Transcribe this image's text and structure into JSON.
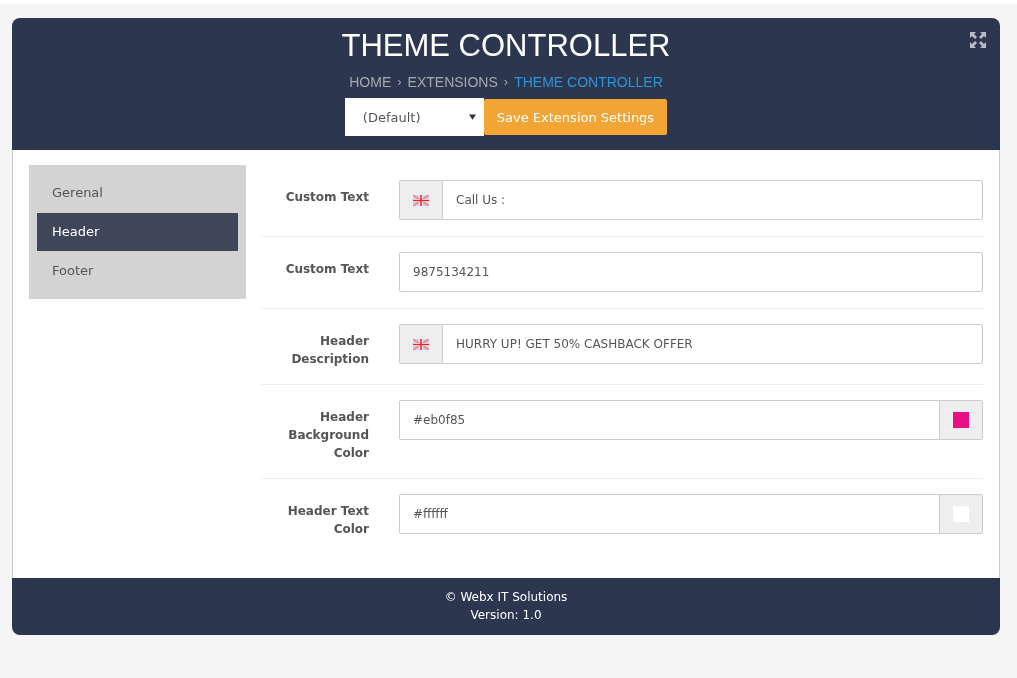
{
  "title": "THEME CONTROLLER",
  "breadcrumb": [
    {
      "label": "HOME",
      "selected": false
    },
    {
      "separator": "›",
      "label": "EXTENSIONS",
      "selected": false
    },
    {
      "separator": "›",
      "label": "THEME CONTROLLER",
      "selected": true
    }
  ],
  "store_select": {
    "value": "(Default)"
  },
  "save_button": "Save Extension Settings",
  "sidebar": {
    "items": [
      {
        "label": "Gerenal",
        "selected": false
      },
      {
        "label": "Header",
        "selected": true
      },
      {
        "label": "Footer",
        "selected": false
      }
    ]
  },
  "fields": [
    {
      "kind": "flag",
      "label": "Custom Text",
      "value": "Call Us :"
    },
    {
      "kind": "plain",
      "label": "Custom Text",
      "value": "9875134211"
    },
    {
      "kind": "flag",
      "label": "Header Description",
      "value": "HURRY UP! GET 50% CASHBACK OFFER"
    },
    {
      "kind": "color",
      "label": "Header Background Color",
      "value": "#eb0f85",
      "color": "#eb0f85"
    },
    {
      "kind": "color",
      "label": "Header Text Color",
      "value": "#ffffff",
      "color": "#ffffff"
    }
  ],
  "footer": {
    "copyright": "© Webx IT Solutions",
    "version": "Version: 1.0"
  }
}
